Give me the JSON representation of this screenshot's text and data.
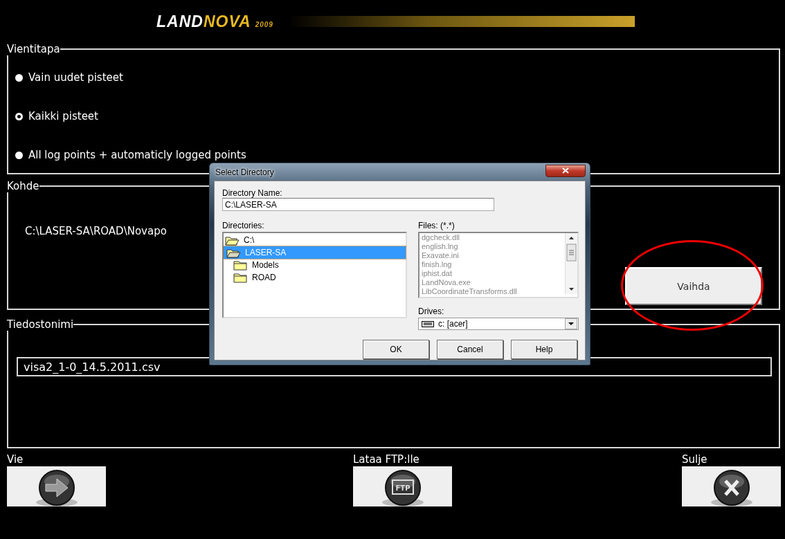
{
  "header": {
    "logo_part_1": "LAND",
    "logo_part_2": "NOVA",
    "logo_year": "2009"
  },
  "export_mode": {
    "title": "Vientitapa",
    "options": [
      {
        "label": "Vain uudet pisteet",
        "selected": false
      },
      {
        "label": "Kaikki pisteet",
        "selected": true
      },
      {
        "label": "All log points + automaticly logged points",
        "selected": false
      }
    ]
  },
  "target": {
    "title": "Kohde",
    "path": "C:\\LASER-SA\\ROAD\\Novapo",
    "button": "Vaihda"
  },
  "filename": {
    "title": "Tiedostonimi",
    "value": "visa2_1-0_14.5.2011.csv"
  },
  "actions": [
    {
      "label": "Vie",
      "kind": "arrow"
    },
    {
      "label": "Lataa FTP:lle",
      "kind": "ftp",
      "icon_text": "FTP"
    },
    {
      "label": "Sulje",
      "kind": "close"
    }
  ],
  "dialog": {
    "title": "Select Directory",
    "name_label": "Directory Name:",
    "name_value": "C:\\LASER-SA",
    "directories_label": "Directories:",
    "directories": [
      {
        "name": "C:\\",
        "kind": "root",
        "selected": false
      },
      {
        "name": "LASER-SA",
        "kind": "current",
        "selected": true
      },
      {
        "name": "Models",
        "kind": "child",
        "selected": false
      },
      {
        "name": "ROAD",
        "kind": "child",
        "selected": false
      }
    ],
    "files_label": "Files: (*.*)",
    "files": [
      "dgcheck.dll",
      "english.lng",
      "Exavate.ini",
      "finish.lng",
      "iphist.dat",
      "LandNova.exe",
      "LibCoordinateTransforms.dll"
    ],
    "drives_label": "Drives:",
    "drive": "c: [acer]",
    "buttons": [
      "OK",
      "Cancel",
      "Help"
    ]
  }
}
